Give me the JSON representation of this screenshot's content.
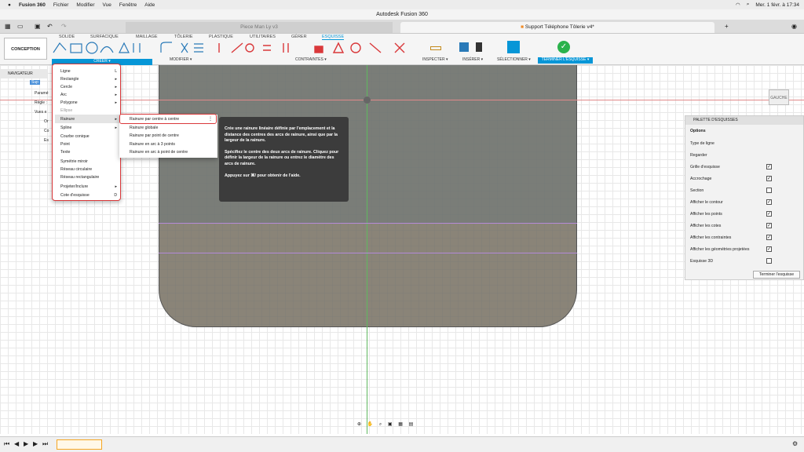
{
  "menubar": {
    "app": "Fusion 360",
    "items": [
      "Fichier",
      "Modifier",
      "Vue",
      "Fenêtre",
      "Aide"
    ],
    "clock": "Mer. 1 févr. à 17:34"
  },
  "window_title": "Autodesk Fusion 360",
  "doc_tabs": [
    "Piece Man Ly v3",
    "Support Téléphone Tôlerie v4*"
  ],
  "workspace": {
    "mode": "CONCEPTION",
    "tabs": [
      "SOLIDE",
      "SURFACIQUE",
      "MAILLAGE",
      "TÔLERIE",
      "PLASTIQUE",
      "UTILITAIRES",
      "GÉRER",
      "ESQUISSE"
    ],
    "active_tab": "ESQUISSE"
  },
  "ribbon_groups": {
    "creer": "CRÉER ▾",
    "modifier": "MODIFIER ▾",
    "contraintes": "CONTRAINTES ▾",
    "inspecter": "INSPECTER ▾",
    "inserer": "INSÉRER ▾",
    "selectionner": "SÉLECTIONNER ▾",
    "terminer": "TERMINER L'ESQUISSE ▾"
  },
  "navigator": {
    "title": "NAVIGATEUR",
    "rows": [
      "Sup",
      "Paramé",
      "Règle :",
      "Vues e",
      "Or",
      "Co",
      "Es"
    ]
  },
  "create_menu": {
    "items": [
      "Ligne",
      "Rectangle",
      "Cercle",
      "Arc",
      "Polygone",
      "Ellipse",
      "Rainure",
      "Spline",
      "Courbe conique",
      "Point",
      "Texte",
      "Symétrie miroir",
      "Réseau circulaire",
      "Réseau rectangulaire",
      "Projeter/Inclure",
      "Cote d'esquisse"
    ],
    "shortcuts": {
      "ligne": "L",
      "cote": "D"
    }
  },
  "rainure_submenu": [
    "Rainure par centre à centre",
    "Rainure globale",
    "Rainure par point de centre",
    "Rainure en arc à 3 points",
    "Rainure en arc à point de centre"
  ],
  "tooltip": {
    "p1": "Crée une rainure linéaire définie par l'emplacement et la distance des centres des arcs de rainure, ainsi que par la largeur de la rainure.",
    "p2": "Spécifiez le centre des deux arcs de rainure. Cliquez pour définir la largeur de la rainure ou entrez le diamètre des arcs de rainure.",
    "p3": "Appuyez sur ⌘/ pour obtenir de l'aide."
  },
  "palette": {
    "title": "PALETTE D'ESQUISSES",
    "section": "Options",
    "rows": [
      {
        "label": "Type de ligne",
        "checked": null
      },
      {
        "label": "Regarder",
        "checked": null
      },
      {
        "label": "Grille d'esquisse",
        "checked": true
      },
      {
        "label": "Accrochage",
        "checked": true
      },
      {
        "label": "Section",
        "checked": false
      },
      {
        "label": "Afficher le contour",
        "checked": true
      },
      {
        "label": "Afficher les points",
        "checked": true
      },
      {
        "label": "Afficher les cotes",
        "checked": true
      },
      {
        "label": "Afficher les contraintes",
        "checked": true
      },
      {
        "label": "Afficher les géométries projetées",
        "checked": true
      },
      {
        "label": "Esquisse 3D",
        "checked": false
      }
    ],
    "finish_button": "Terminer l'esquisse"
  },
  "viewcube": {
    "face": "GAUCHE"
  },
  "colors": {
    "accent": "#0696d7",
    "highlight": "#d9383a",
    "sheet": "#8a8478"
  }
}
